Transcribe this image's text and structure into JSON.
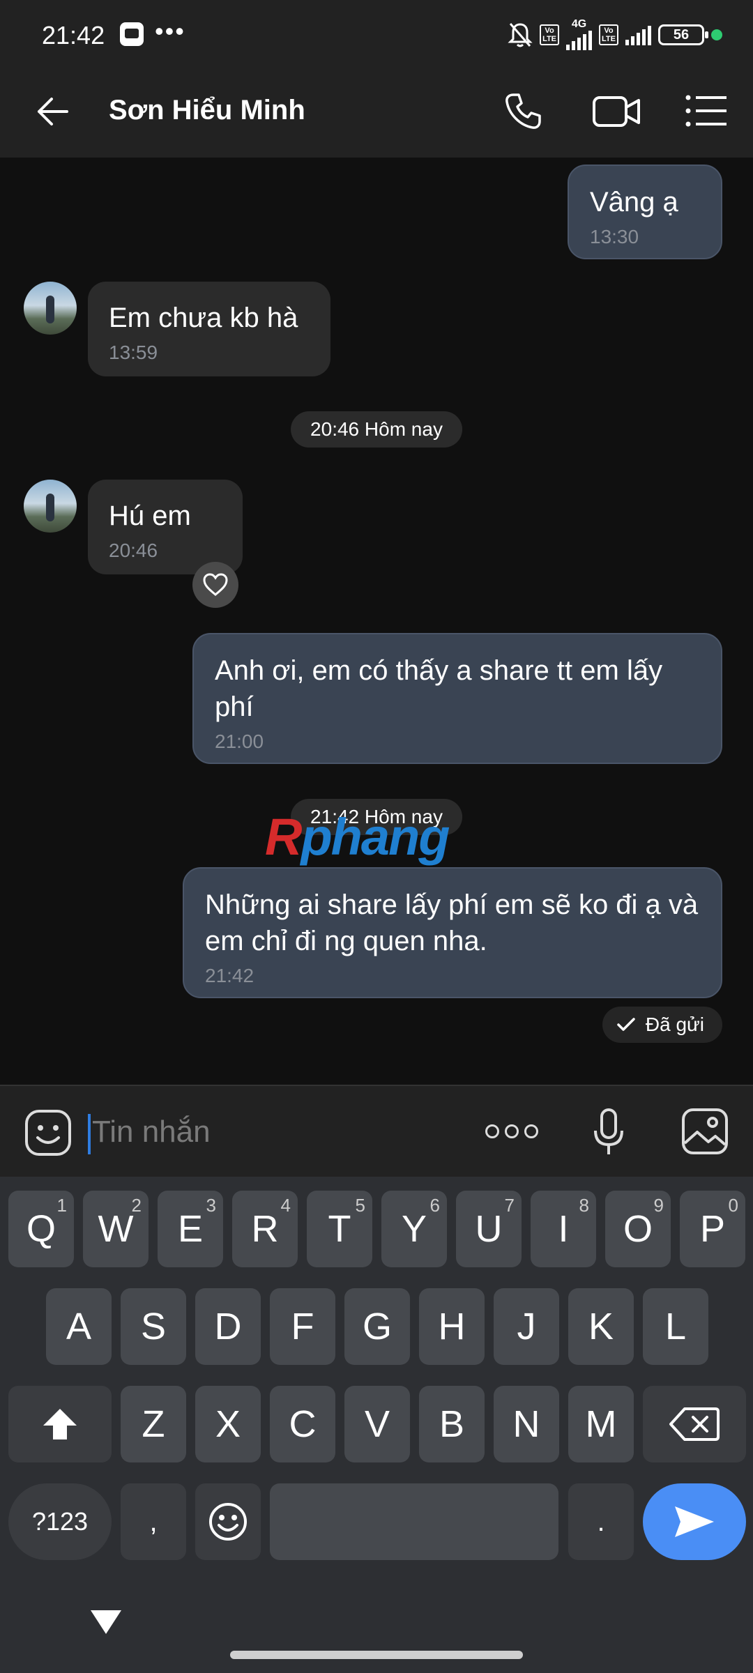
{
  "status_bar": {
    "time": "21:42",
    "more": "•••",
    "network": "4G",
    "volte": "Vo LTE",
    "battery": "56"
  },
  "header": {
    "title": "Sơn Hiểu Minh",
    "back_icon": "arrow-left-icon",
    "call_icon": "phone-icon",
    "video_icon": "video-camera-icon",
    "menu_icon": "list-menu-icon"
  },
  "messages": [
    {
      "side": "me",
      "text": "Vâng ạ",
      "time": "13:30"
    },
    {
      "side": "them",
      "text": "Em chưa kb hà",
      "time": "13:59"
    },
    {
      "side": "date",
      "text": "20:46 Hôm nay"
    },
    {
      "side": "them",
      "text": "Hú em",
      "time": "20:46"
    },
    {
      "side": "me",
      "text": "Anh ơi, em có thấy a share tt em lấy phí",
      "time": "21:00"
    },
    {
      "side": "date",
      "text": "21:42 Hôm nay"
    },
    {
      "side": "me",
      "text": "Những ai share lấy phí em sẽ ko đi ạ và em chỉ đi ng quen nha.",
      "time": "21:42"
    }
  ],
  "sent_status": "Đã gửi",
  "watermark": {
    "part1": "R",
    "part2": "phang"
  },
  "input": {
    "placeholder": "Tin nhắn",
    "value": ""
  },
  "keyboard": {
    "row1": [
      "Q",
      "W",
      "E",
      "R",
      "T",
      "Y",
      "U",
      "I",
      "O",
      "P"
    ],
    "row1_hints": [
      "1",
      "2",
      "3",
      "4",
      "5",
      "6",
      "7",
      "8",
      "9",
      "0"
    ],
    "row2": [
      "A",
      "S",
      "D",
      "F",
      "G",
      "H",
      "J",
      "K",
      "L"
    ],
    "row3": [
      "Z",
      "X",
      "C",
      "V",
      "B",
      "N",
      "M"
    ],
    "sym_label": "?123",
    "comma": ",",
    "period": "."
  },
  "colors": {
    "accent": "#4a8ef5",
    "bubble_me": "#3a4453",
    "bubble_them": "#2b2b2b",
    "background": "#101010"
  }
}
